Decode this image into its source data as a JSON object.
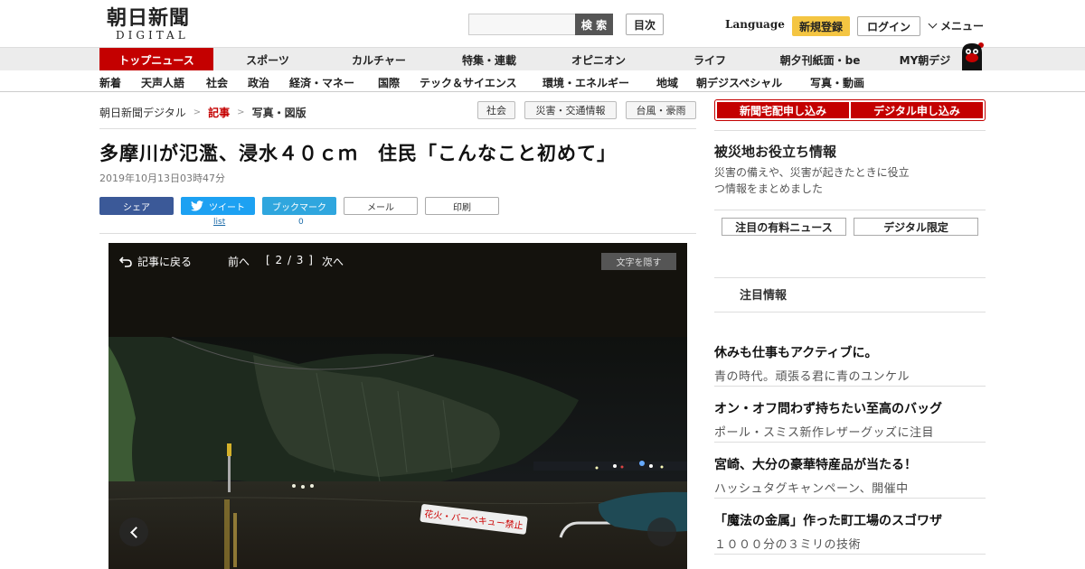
{
  "header": {
    "logo_jp": "朝日新聞",
    "logo_en": "DIGITAL",
    "search_placeholder": "",
    "search_label": "検 索",
    "toc_label": "目次",
    "language_label": "Language",
    "register_label": "新規登録",
    "login_label": "ログイン",
    "menu_label": "メニュー"
  },
  "nav1": {
    "items": [
      "トップニュース",
      "スポーツ",
      "カルチャー",
      "特集・連載",
      "オピニオン",
      "ライフ",
      "朝夕刊紙面・be",
      "MY朝デジ"
    ]
  },
  "nav2": {
    "items": [
      "新着",
      "天声人語",
      "社会",
      "政治",
      "経済・マネー",
      "国際",
      "テック＆サイエンス",
      "環境・エネルギー",
      "地域",
      "朝デジスペシャル",
      "写真・動画"
    ]
  },
  "breadcrumb": {
    "items": [
      "朝日新聞デジタル",
      "記事",
      "写真・図版"
    ],
    "separator": ">"
  },
  "tags": [
    "社会",
    "災害・交通情報",
    "台風・豪雨"
  ],
  "article": {
    "headline": "多摩川が氾濫、浸水４０ｃｍ　住民「こんなこと初めて」",
    "date": "2019年10月13日03時47分"
  },
  "share": {
    "facebook": "シェア",
    "twitter": "ツイート",
    "twitter_count": "list",
    "bookmark": "ブックマーク",
    "bookmark_count": "0",
    "mail": "メール",
    "print": "印刷"
  },
  "viewer": {
    "back_label": "記事に戻る",
    "prev_label": "前へ",
    "counter": "[ 2 / 3 ]",
    "next_label": "次へ",
    "hide_text_label": "文字を隠す",
    "sign_text": "花火・バーベキュー禁止"
  },
  "sidebar": {
    "order_home": "新聞宅配申し込み",
    "order_digital": "デジタル申し込み",
    "disaster_title": "被災地お役立ち情報",
    "disaster_desc": "災害の備えや、災害が起きたときに役立つ情報をまとめました",
    "pick_paid": "注目の有料ニュース",
    "pick_digital": "デジタル限定",
    "featured_label": "注目情報",
    "promos": [
      {
        "title": "休みも仕事もアクティブに。",
        "sub": "青の時代。頑張る君に青のユンケル"
      },
      {
        "title": "オン・オフ問わず持ちたい至高のバッグ",
        "sub": "ポール・スミス新作レザーグッズに注目"
      },
      {
        "title": "宮崎、大分の豪華特産品が当たる！",
        "sub": "ハッシュタグキャンペーン、開催中"
      },
      {
        "title": "「魔法の金属」作った町工場のスゴワザ",
        "sub": "１０００分の３ミリの技術"
      }
    ]
  },
  "colors": {
    "brand_red": "#c40000",
    "register_yellow": "#f4c542",
    "facebook": "#3b5998",
    "twitter": "#1da1f2",
    "viewer_bg": "#14120d"
  }
}
